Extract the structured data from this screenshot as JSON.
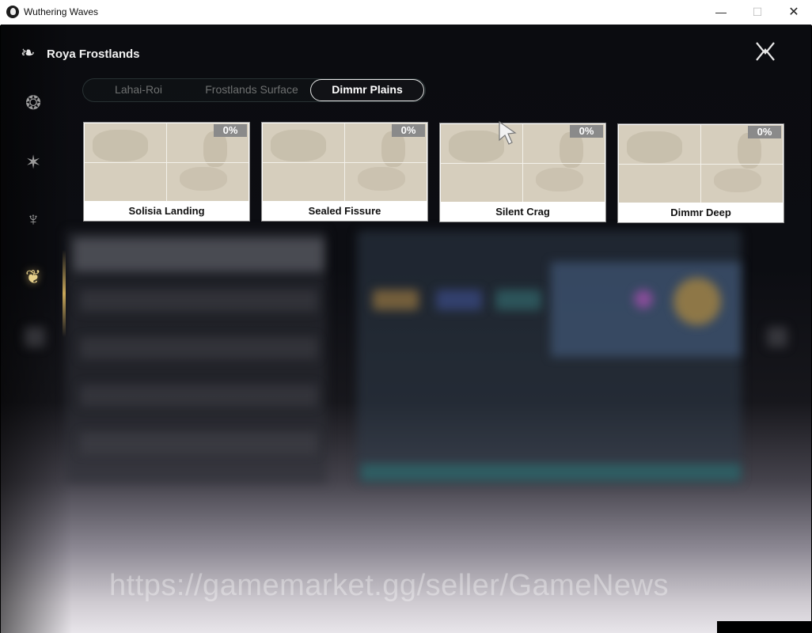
{
  "window": {
    "title": "Wuthering Waves",
    "controls": {
      "minimize": "—",
      "maximize": "☐",
      "close": "✕"
    }
  },
  "header": {
    "region_title": "Roya Frostlands"
  },
  "tabs": [
    {
      "label": "Lahai-Roi",
      "active": false
    },
    {
      "label": "Frostlands Surface",
      "active": false
    },
    {
      "label": "Dimmr Plains",
      "active": true
    }
  ],
  "areas": [
    {
      "name": "Solisia Landing",
      "progress": "0%"
    },
    {
      "name": "Sealed Fissure",
      "progress": "0%"
    },
    {
      "name": "Silent Crag",
      "progress": "0%"
    },
    {
      "name": "Dimmr Deep",
      "progress": "0%"
    }
  ],
  "sidebar": {
    "icons": [
      {
        "name": "region-emblem-1-icon",
        "glyph": "❂"
      },
      {
        "name": "region-emblem-2-icon",
        "glyph": "✶"
      },
      {
        "name": "region-emblem-3-icon",
        "glyph": "♆"
      },
      {
        "name": "region-emblem-4-icon",
        "glyph": "❦",
        "active": true
      }
    ]
  },
  "watermark": "https://gamemarket.gg/seller/GameNews",
  "colors": {
    "active_tab_border": "#e4e4e4",
    "progress_badge": "#8a8a8a",
    "map_tile": "#d6cebd",
    "active_rail": "#e7d08a"
  }
}
